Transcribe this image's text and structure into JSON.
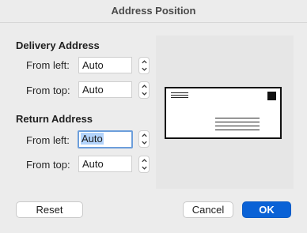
{
  "dialog": {
    "title": "Address Position"
  },
  "delivery": {
    "heading": "Delivery Address",
    "from_left_label": "From left:",
    "from_left_value": "Auto",
    "from_top_label": "From top:",
    "from_top_value": "Auto"
  },
  "return_addr": {
    "heading": "Return Address",
    "from_left_label": "From left:",
    "from_left_value": "Auto",
    "from_top_label": "From top:",
    "from_top_value": "Auto"
  },
  "buttons": {
    "reset": "Reset",
    "cancel": "Cancel",
    "ok": "OK"
  },
  "colors": {
    "accent": "#0a62d6",
    "focus_ring": "#6c9edb",
    "selection": "#b3d4fc"
  }
}
